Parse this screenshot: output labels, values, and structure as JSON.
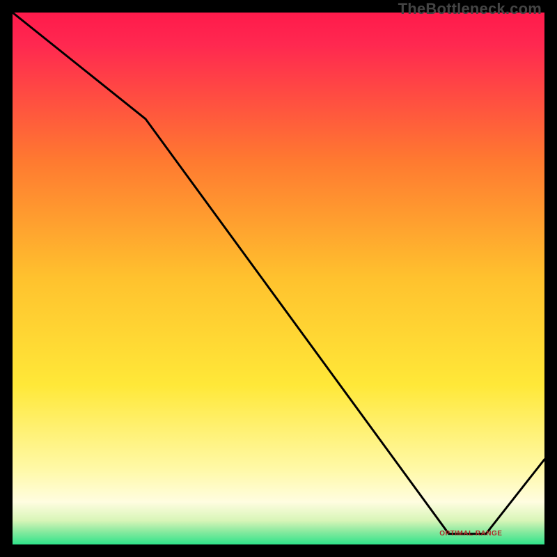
{
  "watermark": "TheBottleneck.com",
  "annotation_label": "OPTIMAL RANGE",
  "colors": {
    "gradient_top": "#ff1a4b",
    "gradient_mid1": "#ff8a2a",
    "gradient_mid2": "#ffe838",
    "gradient_low": "#fffdd0",
    "gradient_bottom": "#2fe38a",
    "line": "#000000",
    "annotation": "#b02626"
  },
  "chart_data": {
    "type": "line",
    "title": "",
    "xlabel": "",
    "ylabel": "",
    "xlim": [
      0,
      100
    ],
    "ylim": [
      0,
      100
    ],
    "x": [
      0,
      25,
      82,
      89,
      100
    ],
    "values": [
      100,
      80,
      2,
      2,
      16
    ],
    "optimal_range_x": [
      82,
      89
    ],
    "annotation": "OPTIMAL RANGE"
  }
}
